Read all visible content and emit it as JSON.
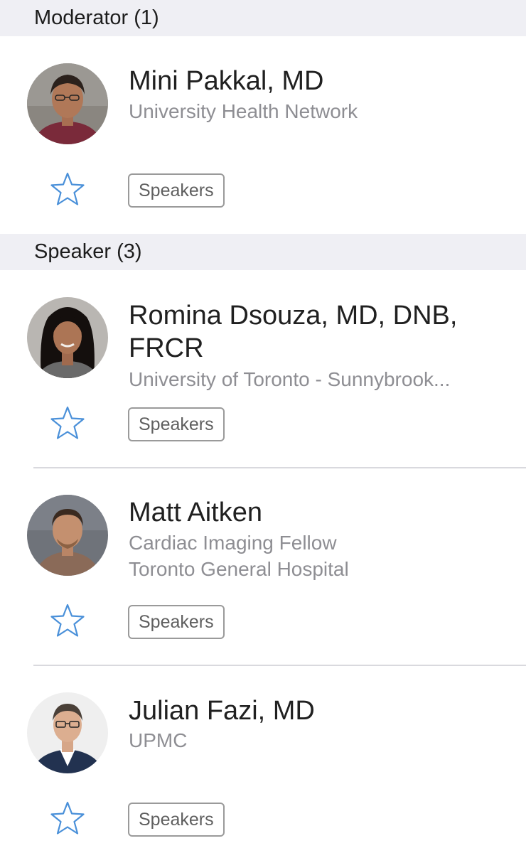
{
  "sections": [
    {
      "header": "Moderator (1)",
      "people": [
        {
          "name": "Mini Pakkal, MD",
          "lines": [
            "University Health Network"
          ],
          "tag": "Speakers"
        }
      ]
    },
    {
      "header": "Speaker (3)",
      "people": [
        {
          "name": "Romina Dsouza, MD, DNB, FRCR",
          "lines": [
            "University of Toronto - Sunnybrook..."
          ],
          "tag": "Speakers"
        },
        {
          "name": "Matt Aitken",
          "lines": [
            "Cardiac Imaging Fellow",
            "Toronto General Hospital"
          ],
          "tag": "Speakers"
        },
        {
          "name": "Julian Fazi, MD",
          "lines": [
            "UPMC"
          ],
          "tag": "Speakers"
        }
      ]
    }
  ],
  "icons": {
    "favorite": "star-outline-icon"
  },
  "colors": {
    "star": "#4a90d9",
    "header_bg": "#efeff4",
    "subtitle": "#8e8e93"
  }
}
